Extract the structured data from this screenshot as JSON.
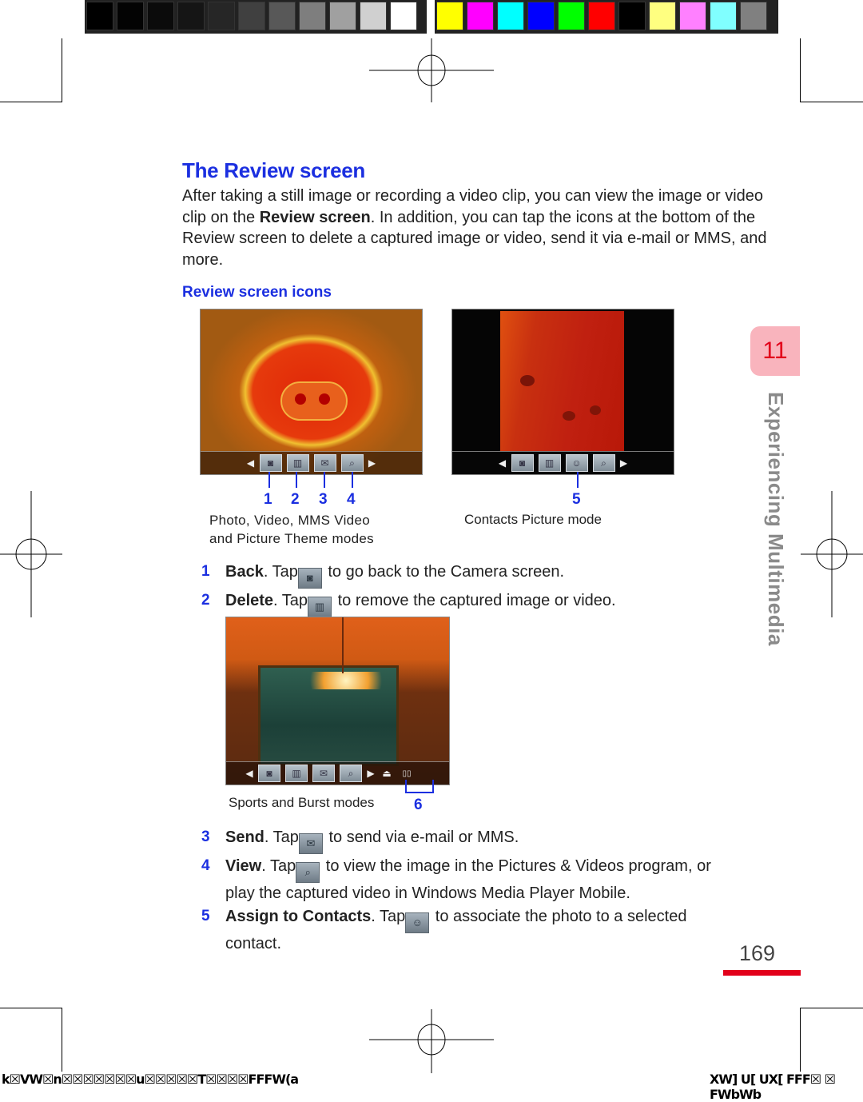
{
  "calibration": {
    "gray_swatches": [
      "#000000",
      "#030303",
      "#0b0b0b",
      "#151515",
      "#262626",
      "#404040",
      "#585858",
      "#7e7e7e",
      "#a0a0a0",
      "#d0d0d0",
      "#ffffff"
    ],
    "color_swatches": [
      "#ffff00",
      "#ff00ff",
      "#00ffff",
      "#0000ff",
      "#00ff00",
      "#ff0000",
      "#000000",
      "#ffff80",
      "#ff80ff",
      "#80ffff",
      "#808080"
    ]
  },
  "section": {
    "title": "The Review screen",
    "intro_part1": "After taking a still image or recording a video clip, you can view the image or video clip on the ",
    "intro_bold": "Review screen",
    "intro_part2": ". In addition, you can tap the icons at the bottom of the Review screen to delete a captured image or video, send it via e-mail or MMS, and more.",
    "subheading": "Review screen icons"
  },
  "figures": {
    "fig1": {
      "callouts": [
        "1",
        "2",
        "3",
        "4"
      ],
      "caption_line1": "Photo, Video, MMS Video",
      "caption_line2": "and Picture Theme modes",
      "toolbar_icons": [
        "camera-icon",
        "trash-icon",
        "envelope-icon",
        "magnifier-icon"
      ]
    },
    "fig2": {
      "callouts": [
        "5"
      ],
      "caption": "Contacts Picture mode",
      "toolbar_icons": [
        "camera-icon",
        "trash-icon",
        "contact-icon",
        "magnifier-icon"
      ]
    },
    "fig3": {
      "callouts": [
        "6"
      ],
      "caption": "Sports and Burst modes",
      "toolbar_icons": [
        "camera-icon",
        "trash-icon",
        "envelope-icon",
        "magnifier-icon",
        "eject-icon",
        "frames-icon"
      ]
    }
  },
  "items": [
    {
      "num": "1",
      "label": "Back",
      "pre": ". Tap",
      "icon": "camera-icon",
      "glyph": "📷",
      "post": " to go back to the Camera screen."
    },
    {
      "num": "2",
      "label": "Delete",
      "pre": ". Tap",
      "icon": "trash-icon",
      "glyph": "🗑",
      "post": " to remove the captured image or video."
    },
    {
      "num": "3",
      "label": "Send",
      "pre": ". Tap",
      "icon": "envelope-icon",
      "glyph": "✉",
      "post": " to send via e-mail or MMS."
    },
    {
      "num": "4",
      "label": "View",
      "pre": ". Tap",
      "icon": "magnifier-icon",
      "glyph": "🔍",
      "post": " to view the image in the Pictures & Videos program, or",
      "post2": "play the captured video in Windows Media Player Mobile."
    },
    {
      "num": "5",
      "label": "Assign to Contacts",
      "pre": ". Tap",
      "icon": "contact-icon",
      "glyph": "👤",
      "post": " to associate the photo to a selected",
      "post2": "contact."
    }
  ],
  "chapter": {
    "number": "11",
    "name": "Experiencing Multimedia"
  },
  "page_number": "169",
  "footer": {
    "left": "k☒VW☒n☒☒☒☒☒☒☒u☒☒☒☒☒T☒☒☒☒FFFW(a",
    "right": "XW] U[ UX[ FFF☒ ☒ FWbWb"
  },
  "colors": {
    "accent_blue": "#1b2fe0",
    "accent_red": "#e2001a",
    "tab_pink": "#f9b4bd"
  }
}
